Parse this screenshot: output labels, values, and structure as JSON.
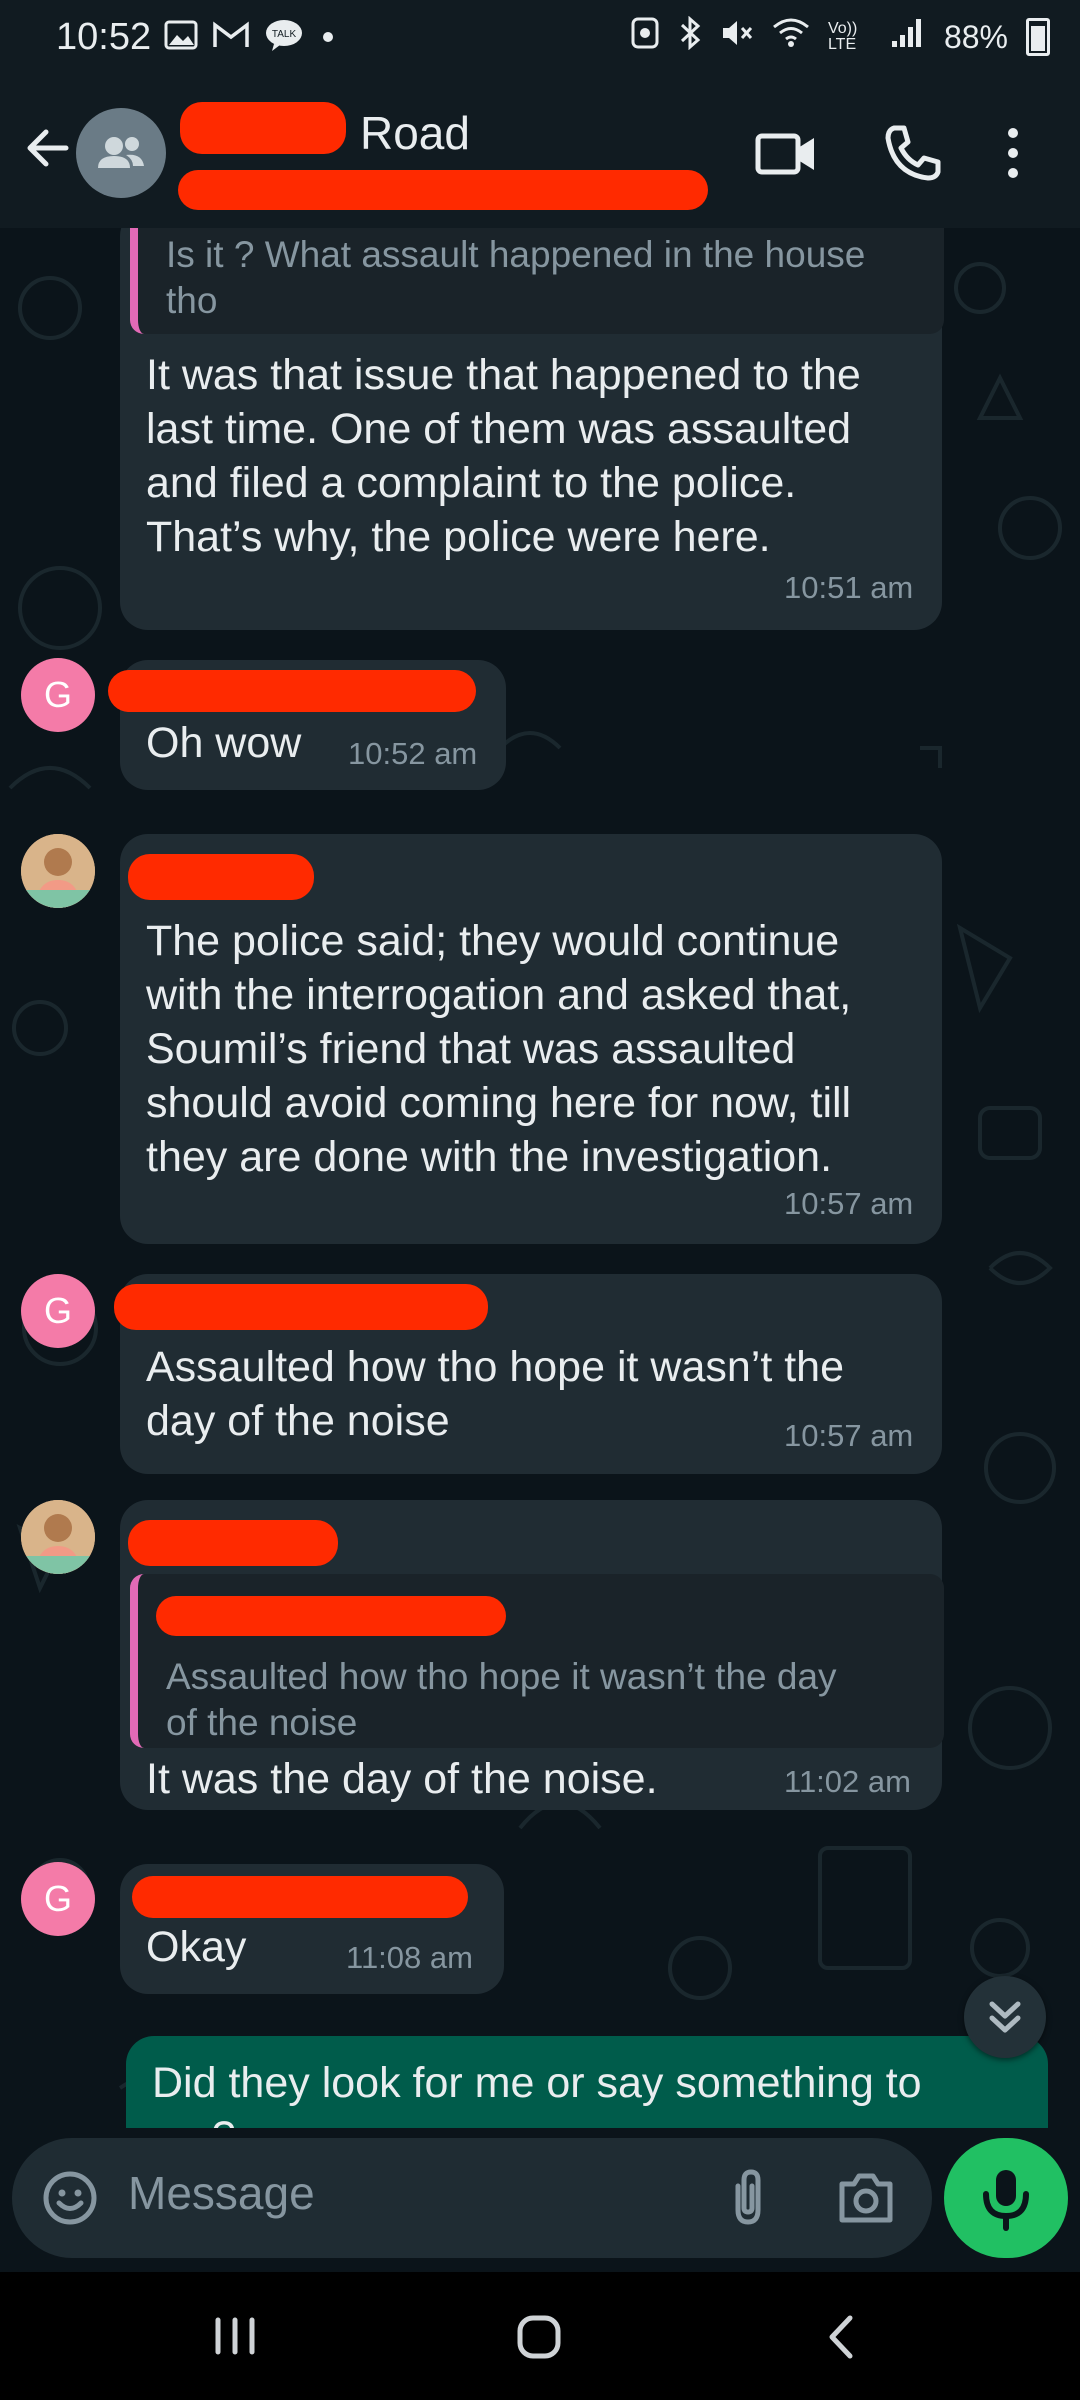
{
  "status_bar": {
    "time": "10:52",
    "battery": "88%",
    "network_label": "Vo)) LTE"
  },
  "header": {
    "title": "Road"
  },
  "messages": [
    {
      "quote": "Is it ? What assault happened in the house tho",
      "lines": [
        "It was that issue that happened to the",
        "last time. One of them was assaulted",
        "and filed a complaint to the police.",
        "That’s why, the police were here."
      ],
      "time": "10:51 am"
    },
    {
      "avatar": "G",
      "lines": [
        "Oh wow"
      ],
      "time": "10:52 am"
    },
    {
      "lines": [
        "The police said; they would continue",
        "with the interrogation and asked that,",
        "Soumil’s  friend that was assaulted",
        "should avoid coming here for now, till",
        "they are done with the investigation."
      ],
      "time": "10:57 am"
    },
    {
      "avatar": "G",
      "lines": [
        "Assaulted how tho hope it wasn’t the",
        "day of the noise"
      ],
      "time": "10:57 am"
    },
    {
      "quote_lines": [
        "Assaulted how tho hope it wasn’t the day",
        "of the noise"
      ],
      "lines": [
        "It was the day of the noise."
      ],
      "time": "11:02 am"
    },
    {
      "avatar": "G",
      "lines": [
        "Okay"
      ],
      "time": "11:08 am"
    },
    {
      "outgoing": true,
      "lines": [
        "Did they look for me or say something to",
        "me?"
      ]
    }
  ],
  "composer": {
    "placeholder": "Message"
  },
  "icons": {
    "back": "arrow-left-icon",
    "video": "video-call-icon",
    "phone": "phone-icon",
    "menu": "more-vert-icon",
    "emoji": "emoji-icon",
    "attach": "paperclip-icon",
    "camera": "camera-icon",
    "mic": "mic-icon",
    "scroll": "double-chevron-down-icon"
  },
  "colors": {
    "accent_green": "#21c063",
    "outgoing_bubble": "#005c4b",
    "incoming_bubble": "#202c33",
    "quote_bar": "#e26ab6",
    "avatar_g": "#f47ba8",
    "redaction": "#ff2a00"
  }
}
